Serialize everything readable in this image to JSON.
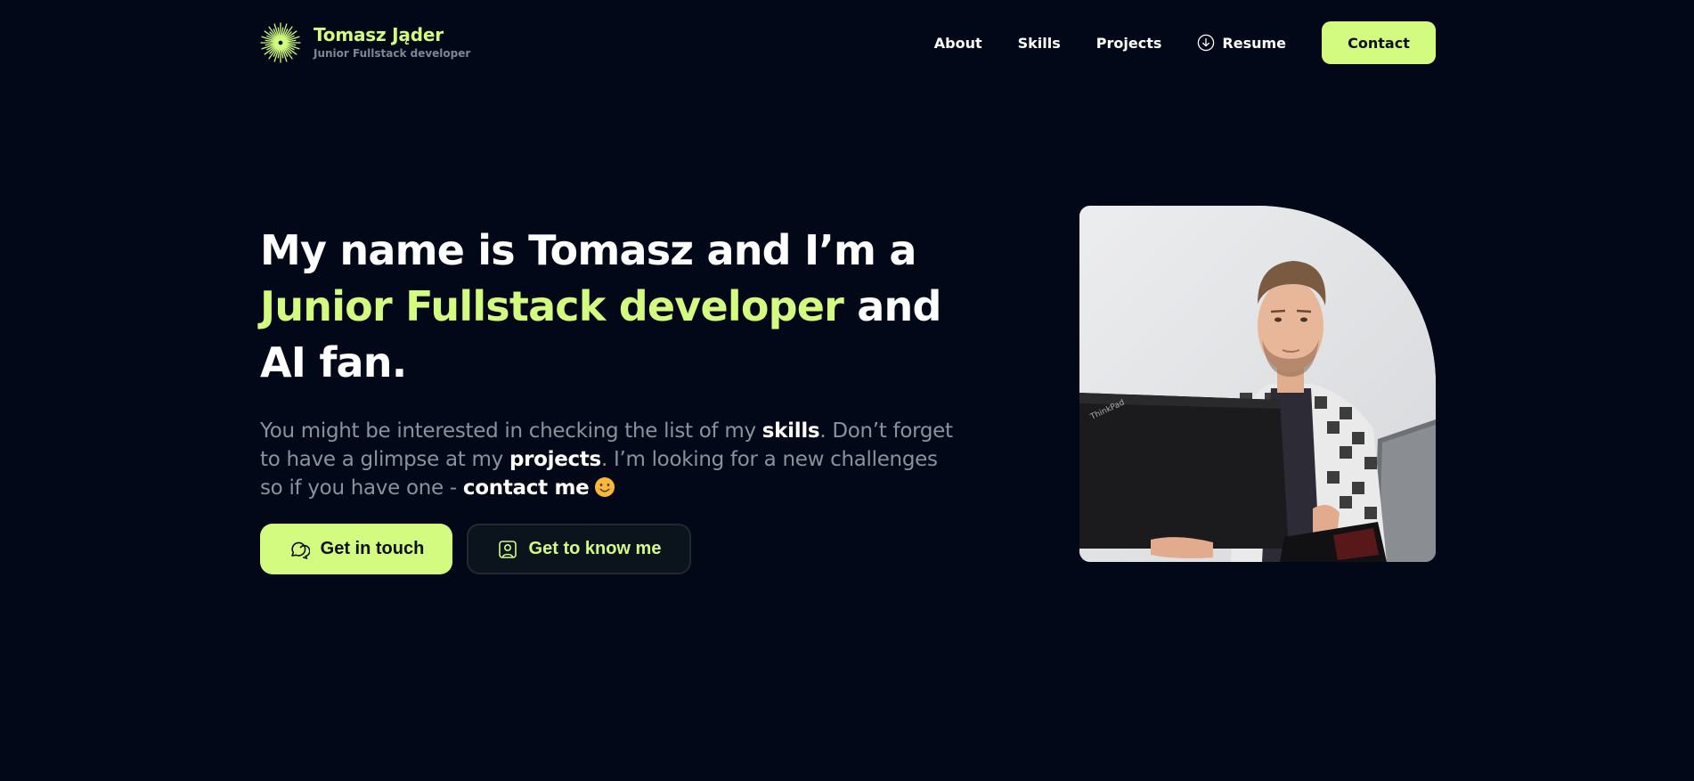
{
  "header": {
    "brand_name": "Tomasz Jąder",
    "brand_subtitle": "Junior Fullstack developer",
    "logo_icon": "sunburst-logo-icon",
    "nav": [
      {
        "label": "About"
      },
      {
        "label": "Skills"
      },
      {
        "label": "Projects"
      },
      {
        "label": "Resume",
        "icon": "download-circle-icon"
      }
    ],
    "contact_label": "Contact"
  },
  "hero": {
    "title_part1": "My name is Tomasz and I’m a ",
    "title_accent": "Junior Fullstack developer",
    "title_part2": " and AI fan.",
    "desc_part1": "You might be interested in checking the list of my ",
    "desc_skills": "skills",
    "desc_part2": ". Don’t forget to have a glimpse at my ",
    "desc_projects": "projects",
    "desc_part3": ". I’m looking for a new challenges so if you have one - ",
    "desc_contact": "contact me",
    "emoji_icon": "smiling-face-emoji-icon",
    "primary_button": "Get in touch",
    "primary_icon": "chat-bubble-icon",
    "secondary_button": "Get to know me",
    "secondary_icon": "user-square-icon",
    "photo_icon": "profile-photo"
  },
  "colors": {
    "background": "#020817",
    "accent": "#d2fb7f",
    "muted_text": "#8c919b",
    "text": "#ffffff"
  }
}
